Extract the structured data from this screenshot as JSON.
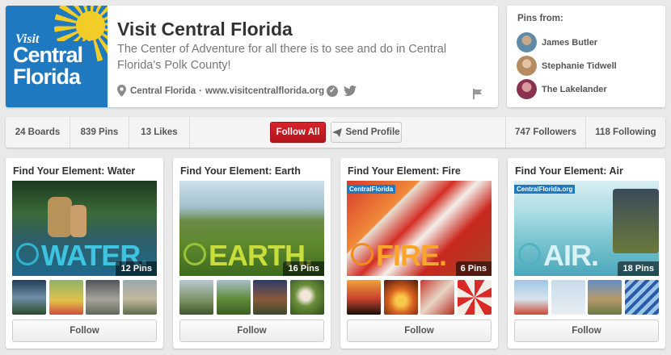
{
  "profile": {
    "logo": {
      "line1": "Visit",
      "line2": "Central",
      "line3": "Florida"
    },
    "name": "Visit Central Florida",
    "description": "The Center of Adventure for all there is to see and do in Central Florida's Polk County!",
    "location": "Central Florida",
    "separator": "·",
    "website": "www.visitcentralflorida.org"
  },
  "pins_from": {
    "title": "Pins from:",
    "users": [
      {
        "name": "James Butler"
      },
      {
        "name": "Stephanie Tidwell"
      },
      {
        "name": "The Lakelander"
      }
    ]
  },
  "stats": {
    "boards": "24 Boards",
    "pins": "839 Pins",
    "likes": "13 Likes",
    "follow_all": "Follow All",
    "send_profile": "Send Profile",
    "followers": "747 Followers",
    "following": "118 Following"
  },
  "boards": [
    {
      "title": "Find Your Element: Water",
      "word": "WATER.",
      "pins": "12 Pins",
      "follow": "Follow"
    },
    {
      "title": "Find Your Element: Earth",
      "word": "EARTH.",
      "pins": "16 Pins",
      "follow": "Follow"
    },
    {
      "title": "Find Your Element: Fire",
      "word": "FIRE.",
      "pins": "6 Pins",
      "follow": "Follow",
      "logo_tag": "CentralFlorida"
    },
    {
      "title": "Find Your Element: Air",
      "word": "AIR.",
      "pins": "18 Pins",
      "follow": "Follow",
      "logo_tag": "CentralFlorida.org"
    }
  ],
  "colors": {
    "accent_red": "#cb2027",
    "brand_blue": "#1f79c0",
    "sun_yellow": "#ffd21f"
  },
  "icons": [
    "location-pin-icon",
    "verified-check-icon",
    "twitter-icon",
    "flag-icon",
    "send-icon"
  ]
}
